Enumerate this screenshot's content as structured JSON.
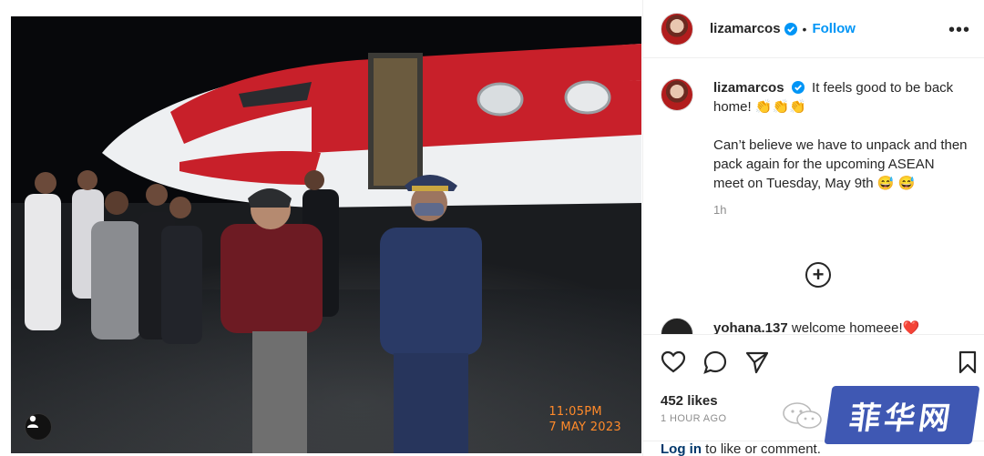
{
  "post": {
    "photo": {
      "timestamp_time": "11:05PM",
      "timestamp_date": "7 MAY 2023",
      "description": "Night arrival at airport tarmac with red and white private jet"
    },
    "author": {
      "username": "lizamarcos",
      "verified": true,
      "follow_label": "Follow",
      "separator": "•"
    },
    "caption": {
      "text_line1": " It feels good to be back home! 👏👏👏",
      "text_rest": "Can’t believe we have to unpack and then pack again for the upcoming ASEAN meet on Tuesday, May 9th 😅 😅",
      "time": "1h"
    },
    "comment_peek": {
      "username": "yohana.137",
      "text": "welcome homeee!❤️"
    },
    "likes": "452 likes",
    "ago": "1 HOUR AGO",
    "login": {
      "link": "Log in",
      "rest": " to like or comment."
    }
  },
  "watermark": {
    "text": "菲华网"
  },
  "colors": {
    "accent": "#0095f6",
    "timestamp": "#ff8a2a",
    "watermark": "#3f58b3"
  },
  "icons": [
    "more-icon",
    "verified-icon",
    "add-comment-icon",
    "heart-icon",
    "comment-icon",
    "share-icon",
    "bookmark-icon",
    "user-tag-icon"
  ]
}
